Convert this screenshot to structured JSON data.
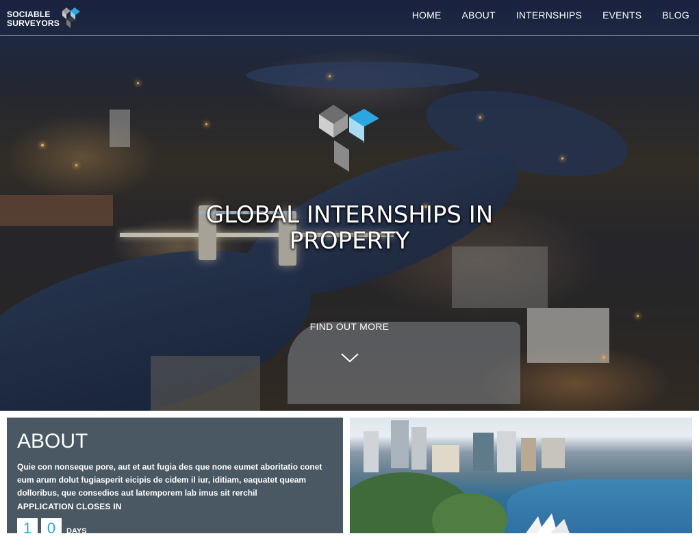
{
  "brand": {
    "line1": "SOCIABLE",
    "line2": "SURVEYORS"
  },
  "nav": [
    {
      "label": "HOME"
    },
    {
      "label": "ABOUT"
    },
    {
      "label": "INTERNSHIPS"
    },
    {
      "label": "EVENTS"
    },
    {
      "label": "BLOG"
    }
  ],
  "hero": {
    "title_line1": "GLOBAL INTERNSHIPS IN",
    "title_line2": "PROPERTY",
    "cta": "FIND OUT MORE"
  },
  "about": {
    "heading": "ABOUT",
    "body": "Quie con nonseque pore, aut et aut fugia des que none eumet aboritatio conet eum arum dolut fugiasperit eicipis de cidem il iur, iditiam, eaquatet queam dolloribus, que consedios aut latemporem lab imus sit rerchil",
    "closes_label": "APPLICATION CLOSES IN",
    "countdown": {
      "digit1": "1",
      "digit2": "0",
      "unit": "DAYS"
    }
  },
  "colors": {
    "accent": "#29a4d8",
    "card": "#4a5863"
  },
  "icons": {
    "logo": "cube-logo-icon",
    "scroll": "chevron-down-icon"
  }
}
